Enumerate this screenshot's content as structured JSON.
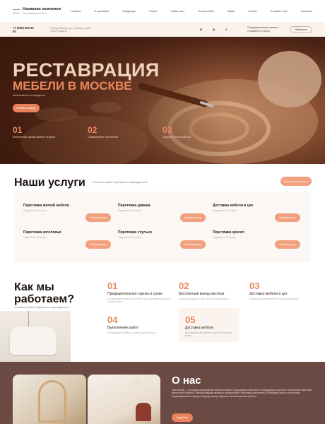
{
  "header": {
    "company_name": "Название компании",
    "company_tagline": "Реставрация мебели",
    "menu": [
      "Главная",
      "О компании",
      "Продукция",
      "Услуги",
      "Прайс-лист",
      "Фотогалерея",
      "Акции",
      "Статьи",
      "Отзывы о нас",
      "Контакты"
    ],
    "phone": "+7 (000) 000 00 00",
    "address": "Город Москва, ул. Пушкина, дом Колотушкина",
    "socials": [
      "vk-icon",
      "ok-icon",
      "telegram-icon"
    ],
    "calc_link": "Предварительная оценка стоимости по фото",
    "cart_label": "Избранное"
  },
  "hero": {
    "title": "РЕСТАВРАЦИЯ",
    "subtitle": "МЕБЕЛИ В МОСКВЕ",
    "note": "Качественно и недорого!",
    "button": "Оставить заявку",
    "features": [
      {
        "num": "01",
        "text": "Бесплатная оценка мебели по фото"
      },
      {
        "num": "02",
        "text": "Современные технологии"
      },
      {
        "num": "03",
        "text": "Гарантия на все работы"
      }
    ]
  },
  "services": {
    "title": "Наши услуги",
    "subtitle": "Стоимость работ подбирается индивидуально",
    "all_button": "Посмотреть все услуги",
    "items": [
      {
        "title": "Перетяжка мягкой мебели",
        "sub": "Подробнее об услуге",
        "button": "Заказать услугу"
      },
      {
        "title": "Перетяжка дивана",
        "sub": "Подробнее об услуге",
        "button": "Заказать услугу"
      },
      {
        "title": "Доставка мебели в цех",
        "sub": "Подробнее об услуге",
        "button": "Заказать услугу"
      },
      {
        "title": "Перетяжка изголовья",
        "sub": "Подробнее об услуге",
        "button": "Заказать услугу"
      },
      {
        "title": "Перетяжка стульев",
        "sub": "Подробнее об услуге",
        "button": "Заказать услугу"
      },
      {
        "title": "Перетяжка кресел",
        "sub": "Подробнее об услуге",
        "button": "Заказать услугу"
      }
    ]
  },
  "how": {
    "title_line1": "Как мы",
    "title_line2": "работаем?",
    "subtitle": "Стоимость работ подбирается индивидуально",
    "steps": [
      {
        "num": "01",
        "title": "Предварительная оценка и сроки",
        "desc": "Вы присылаете нам фото мебели, мы оцениваем стоимость и сроки работ"
      },
      {
        "num": "02",
        "title": "Бесплатный выезд мастера",
        "desc": "Мастер приезжает к вам, уточняет объем работ"
      },
      {
        "num": "03",
        "title": "Доставка мебели в цех",
        "desc": "Бережно доставим мебель в нашу мастерскую"
      },
      {
        "num": "04",
        "title": "Выполнение работ",
        "desc": "Реставрируем мебель в согласованные сроки"
      },
      {
        "num": "05",
        "title": "Доставка мебели",
        "desc": "Доставляем обновленную мебель в удобное время"
      }
    ]
  },
  "about": {
    "title": "О нас",
    "text": "Мастерская — площадка возвращения мебели к жизни. Предлагаем собой место оборудование для всех этапов работ. Мастера имеют опыт работы с любыми видами мебели и материалами. Работаем качественно, соблюдаем сроки и технологии. Индивидуальный подход к каждому заказу. Гарантия на выполненные работы.",
    "button": "Подробнее"
  },
  "colors": {
    "accent": "#e8835c",
    "accent_light": "#f2a17f",
    "dark_text": "#1e140f",
    "about_bg": "#6b4a43"
  }
}
